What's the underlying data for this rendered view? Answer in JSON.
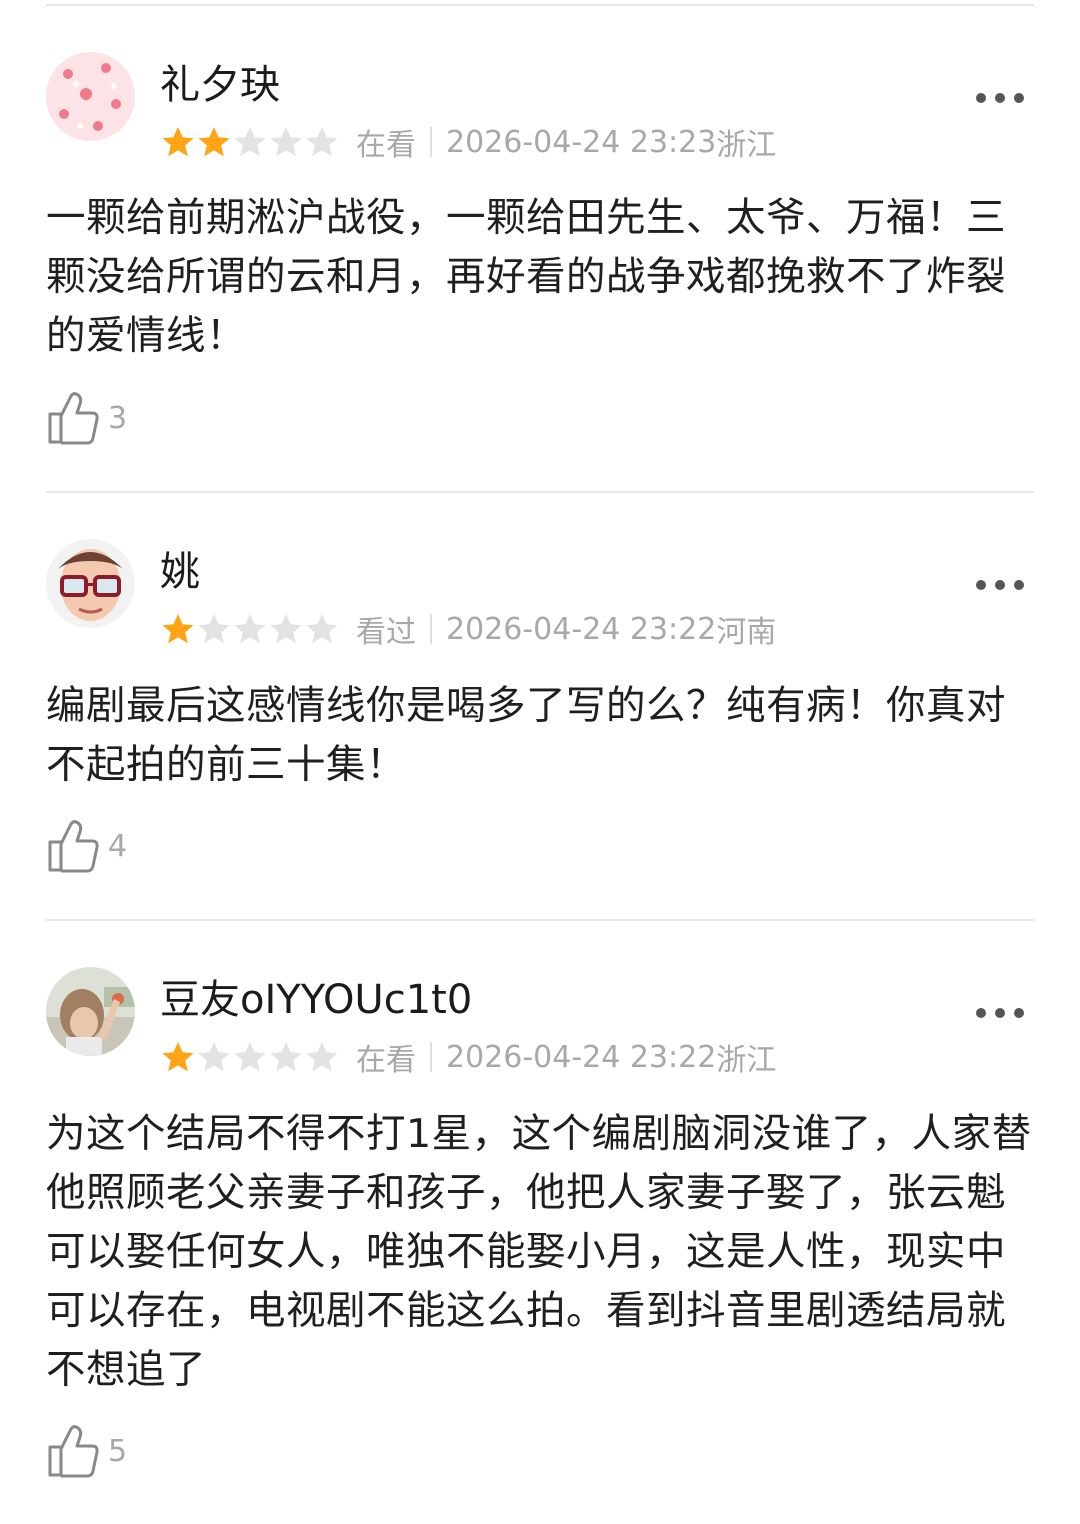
{
  "colors": {
    "star_filled": "#ffa415",
    "star_empty": "#e3e3e3",
    "meta_gray": "#a8a8a8"
  },
  "reviews": [
    {
      "avatar_icon": "strawberry-pattern-avatar",
      "name": "礼夕玦",
      "rating": 2,
      "status": "在看",
      "time": "2026-04-24 23:23",
      "location": "浙江",
      "text": "一颗给前期淞沪战役，一颗给田先生、太爷、万福！三颗没给所谓的云和月，再好看的战争戏都挽救不了炸裂的爱情线！",
      "likes": "3"
    },
    {
      "avatar_icon": "cartoon-man-glasses-avatar",
      "name": "姚",
      "rating": 1,
      "status": "看过",
      "time": "2026-04-24 23:22",
      "location": "河南",
      "text": "编剧最后这感情线你是喝多了写的么？纯有病！你真对不起拍的前三十集！",
      "likes": "4"
    },
    {
      "avatar_icon": "child-photo-avatar",
      "name": "豆友oIYYOUc1t0",
      "rating": 1,
      "status": "在看",
      "time": "2026-04-24 23:22",
      "location": "浙江",
      "text": "为这个结局不得不打1星，这个编剧脑洞没谁了，人家替他照顾老父亲妻子和孩子，他把人家妻子娶了，张云魁可以娶任何女人，唯独不能娶小月，这是人性，现实中可以存在，电视剧不能这么拍。看到抖音里剧透结局就不想追了",
      "likes": "5"
    }
  ]
}
